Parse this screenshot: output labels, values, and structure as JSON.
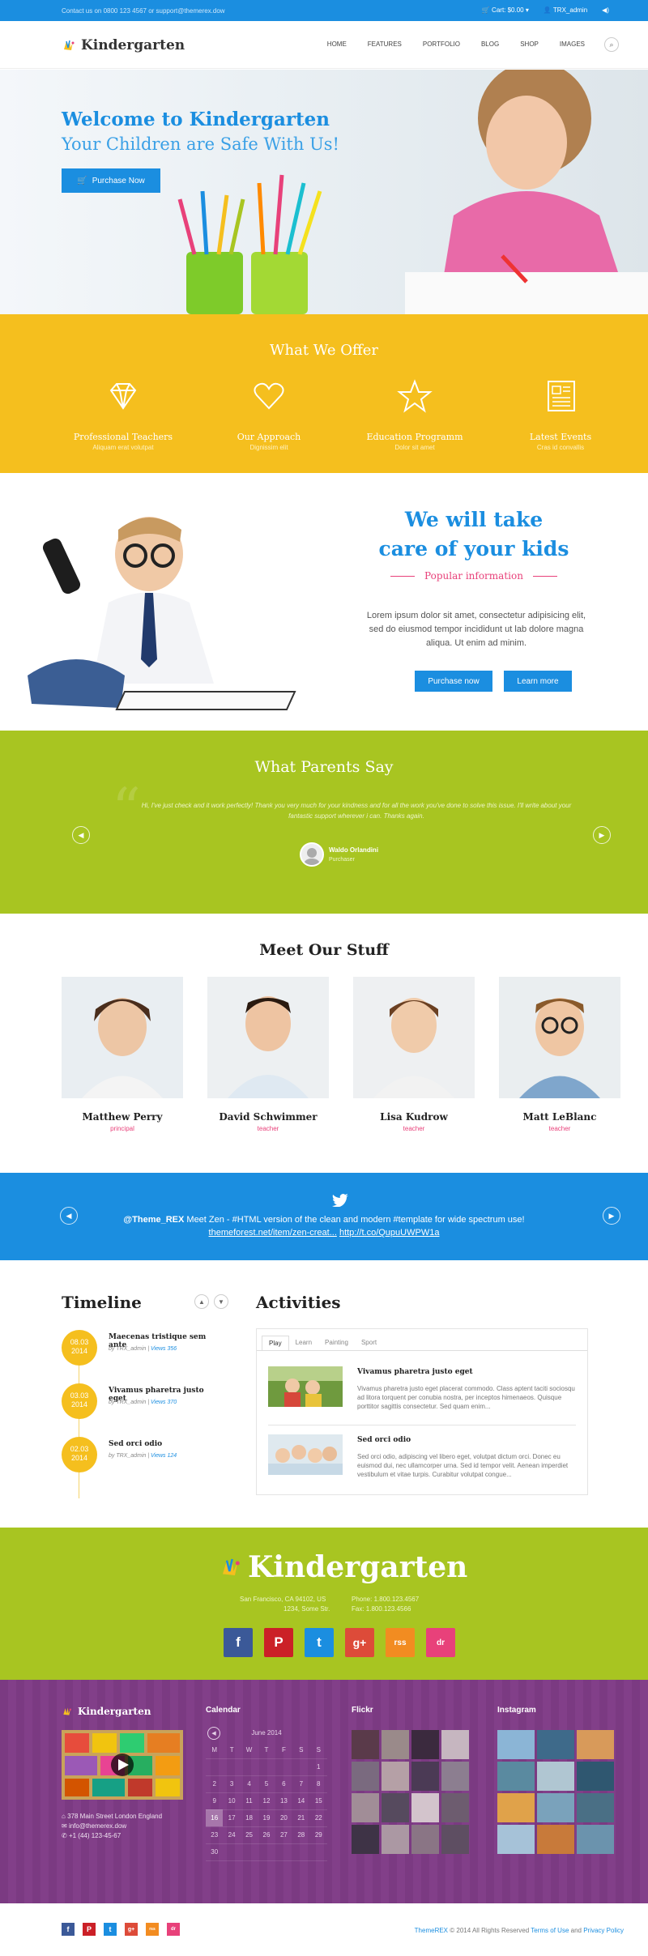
{
  "topbar": {
    "contact": "Contact us on 0800 123 4567 or support@themerex.dow",
    "cart": "Cart: $0.00",
    "user": "TRX_admin"
  },
  "header": {
    "logo": "Kindergarten",
    "nav": [
      "HOME",
      "FEATURES",
      "PORTFOLIO",
      "BLOG",
      "SHOP",
      "IMAGES"
    ]
  },
  "hero": {
    "title": "Welcome to Kindergarten",
    "subtitle": "Your Children are Safe With Us!",
    "button": "Purchase Now"
  },
  "offer": {
    "title": "What We Offer",
    "items": [
      {
        "title": "Professional Teachers",
        "sub": "Aliquam erat volutpat",
        "icon": "diamond-icon"
      },
      {
        "title": "Our Approach",
        "sub": "Dignissim elit",
        "icon": "heart-icon"
      },
      {
        "title": "Education Programm",
        "sub": "Dolor sit amet",
        "icon": "star-icon"
      },
      {
        "title": "Latest Events",
        "sub": "Cras id convallis",
        "icon": "newspaper-icon"
      }
    ]
  },
  "care": {
    "title1": "We will take",
    "title2": "care of your kids",
    "popular": "Popular information",
    "text": "Lorem ipsum dolor sit amet, consectetur adipisicing elit, sed do eiusmod tempor incididunt ut lab dolore magna aliqua. Ut enim ad minim.",
    "btn1": "Purchase now",
    "btn2": "Learn more"
  },
  "parents": {
    "title": "What Parents Say",
    "quote": "Hi, I've just check and it work perfectly! Thank you very much for your kindness and for all the work you've done to solve this issue. I'll write about your fantastic support wherever i can. Thanks again.",
    "name": "Waldo Orlandini",
    "role": "Purchaser"
  },
  "staff": {
    "title": "Meet Our Stuff",
    "people": [
      {
        "name": "Matthew Perry",
        "role": "principal"
      },
      {
        "name": "David Schwimmer",
        "role": "teacher"
      },
      {
        "name": "Lisa Kudrow",
        "role": "teacher"
      },
      {
        "name": "Matt LeBlanc",
        "role": "teacher"
      }
    ]
  },
  "twitter": {
    "line1_handle": "@Theme_REX",
    "line1": " Meet Zen - #HTML version of the clean and modern #template for wide spectrum use!",
    "link1": "themeforest.net/item/zen-creat...",
    "link2": "http://t.co/QupuUWPW1a"
  },
  "timeline": {
    "title": "Timeline",
    "items": [
      {
        "date1": "08.03",
        "date2": "2014",
        "title": "Maecenas tristique sem ante",
        "by": "by TRX_admin",
        "views": "Views 356"
      },
      {
        "date1": "03.03",
        "date2": "2014",
        "title": "Vivamus pharetra justo eget",
        "by": "by TRX_admin",
        "views": "Views 370"
      },
      {
        "date1": "02.03",
        "date2": "2014",
        "title": "Sed orci odio",
        "by": "by TRX_admin",
        "views": "Views 124"
      }
    ]
  },
  "activities": {
    "title": "Activities",
    "tabs": [
      "Play",
      "Learn",
      "Painting",
      "Sport"
    ],
    "items": [
      {
        "title": "Vivamus pharetra justo eget",
        "text": "Vivamus pharetra justo eget placerat commodo. Class aptent taciti sociosqu ad litora torquent per conubia nostra, per inceptos himenaeos. Quisque porttitor sagittis consectetur. Sed quam enim..."
      },
      {
        "title": "Sed orci odio",
        "text": "Sed orci odio, adipiscing vel libero eget, volutpat dictum orci. Donec eu euismod dui, nec ullamcorper urna. Sed id tempor velit. Aenean imperdiet vestibulum et vitae turpis. Curabitur volutpat congue..."
      }
    ]
  },
  "footer": {
    "logo": "Kindergarten",
    "addr1": "San Francisco, CA 94102, US",
    "addr2": "1234, Some Str.",
    "phone": "Phone: 1.800.123.4567",
    "fax": "Fax: 1.800.123.4566",
    "social": [
      "f",
      "P",
      "t",
      "g+",
      "rss",
      "dr"
    ],
    "col_logo": "Kindergarten",
    "col_addr": "378 Main Street London England",
    "col_mail": "info@themerex.dow",
    "col_phone": "+1 (44) 123-45-67",
    "calendar_title": "Calendar",
    "month": "June 2014",
    "days": [
      "M",
      "T",
      "W",
      "T",
      "F",
      "S",
      "S"
    ],
    "flickr": "Flickr",
    "instagram": "Instagram",
    "copy_pre": "ThemeREX",
    "copy_mid": " © 2014 All Rights Reserved ",
    "terms": "Terms of Use",
    "and": " and ",
    "privacy": "Privacy Policy"
  }
}
